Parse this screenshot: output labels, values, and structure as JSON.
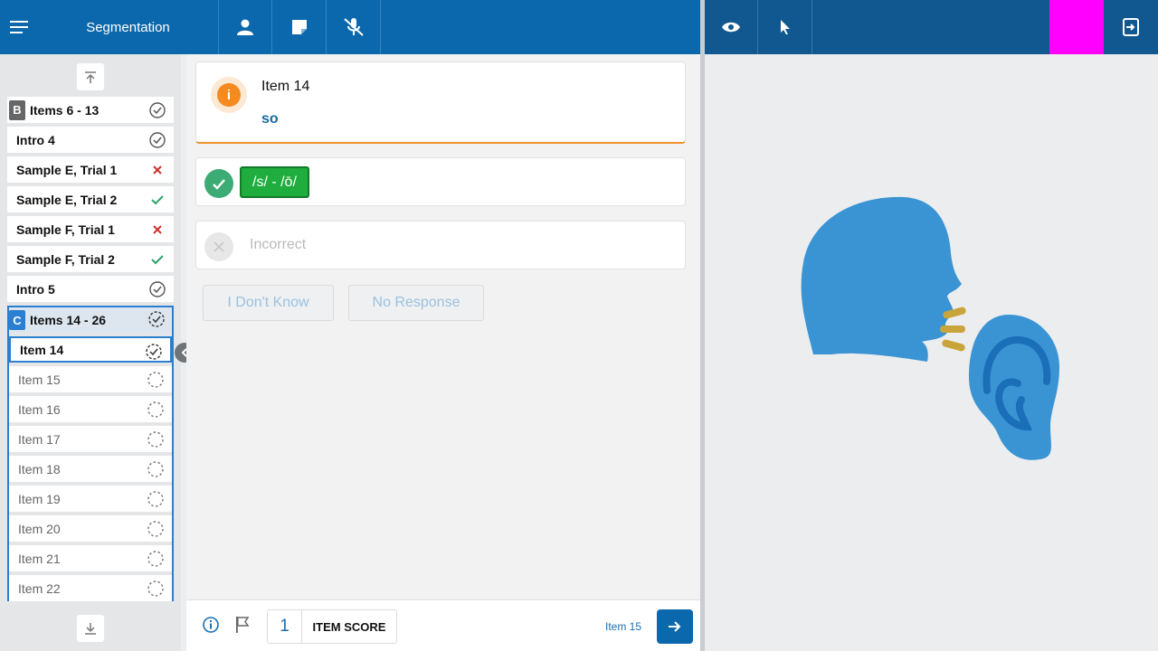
{
  "header": {
    "title": "Segmentation",
    "icons": [
      "menu-icon",
      "person-icon",
      "note-icon",
      "mic-off-icon"
    ],
    "right_icons": [
      "eye-icon",
      "pointer-icon",
      "exit-icon"
    ],
    "accent_color": "#ff00ff"
  },
  "sidebar": {
    "items": [
      {
        "badge": "B",
        "label": "Items 6 - 13",
        "status": "complete"
      },
      {
        "label": "Intro 4",
        "status": "complete"
      },
      {
        "label": "Sample E, Trial 1",
        "status": "incorrect"
      },
      {
        "label": "Sample E, Trial 2",
        "status": "correct"
      },
      {
        "label": "Sample F, Trial 1",
        "status": "incorrect"
      },
      {
        "label": "Sample F, Trial 2",
        "status": "correct"
      },
      {
        "label": "Intro 5",
        "status": "complete"
      }
    ],
    "group": {
      "badge": "C",
      "label": "Items 14 - 26",
      "items": [
        {
          "label": "Item 14",
          "status": "in-progress",
          "current": true
        },
        {
          "label": "Item 15",
          "status": "pending"
        },
        {
          "label": "Item 16",
          "status": "pending"
        },
        {
          "label": "Item 17",
          "status": "pending"
        },
        {
          "label": "Item 18",
          "status": "pending"
        },
        {
          "label": "Item 19",
          "status": "pending"
        },
        {
          "label": "Item 20",
          "status": "pending"
        },
        {
          "label": "Item 21",
          "status": "pending"
        },
        {
          "label": "Item 22",
          "status": "pending"
        }
      ]
    }
  },
  "main": {
    "item_title": "Item 14",
    "item_word": "so",
    "correct_response": "/s/ - /ō/",
    "incorrect_label": "Incorrect",
    "idk_label": "I Don't Know",
    "no_response_label": "No Response"
  },
  "footer": {
    "score_value": "1",
    "score_label": "ITEM SCORE",
    "next_item": "Item 15"
  }
}
